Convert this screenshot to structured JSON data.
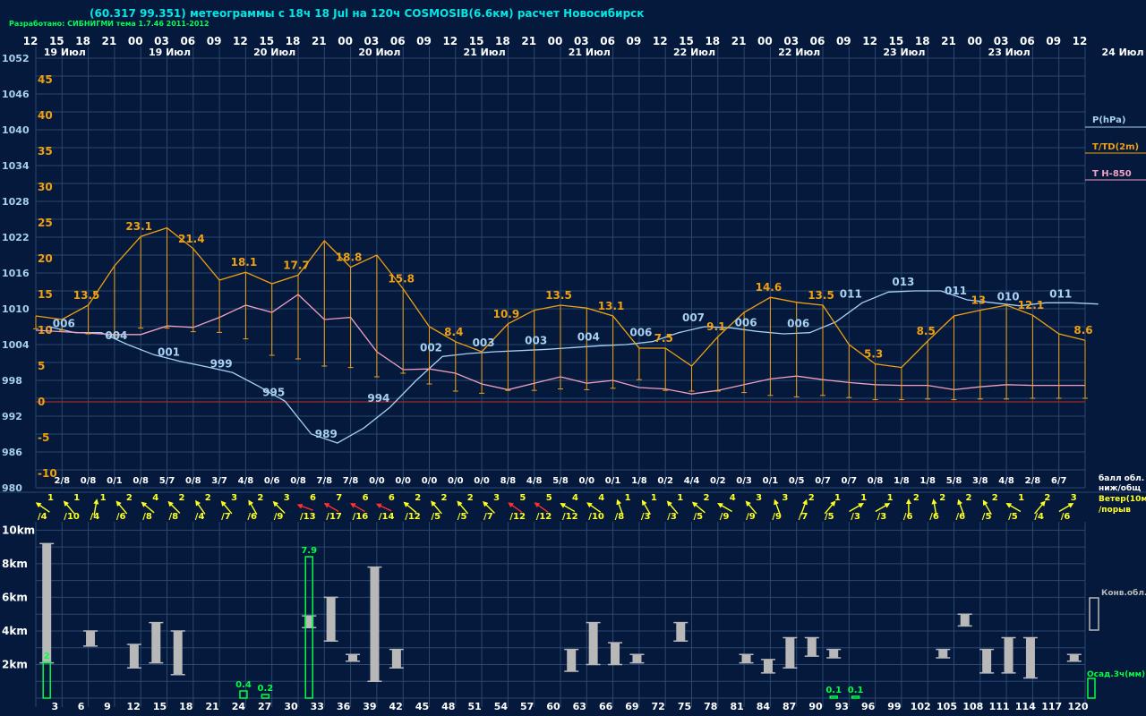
{
  "header": {
    "title": "(60.317 99.351) метеограммы с  18ч 18 Jul на 120ч COSMOSIB(6.6км) расчет Новосибирск",
    "credit": "Разработано: СИБНИГМИ тема 1.7.46 2011-2012"
  },
  "colors": {
    "pressure": "#a8d0f0",
    "temperature": "#f0a010",
    "t850": "#f0a0c0",
    "grid": "#2a4870",
    "zero_line": "#a02828",
    "wind": "#ffff20",
    "wind_strong": "#ff3030",
    "cloud_bar": "#b8b8b8",
    "precip": "#00ff40",
    "text_white": "#ffffff",
    "label_blue": "#a8d0f0",
    "label_orange": "#f0a010"
  },
  "chart_data": {
    "type": "line",
    "hour_ticks": [
      "12",
      "15",
      "18",
      "21",
      "00",
      "03",
      "06",
      "09",
      "12",
      "15",
      "18",
      "21",
      "00",
      "03",
      "06",
      "09",
      "12",
      "15",
      "18",
      "21",
      "00",
      "03",
      "06",
      "09",
      "12",
      "15",
      "18",
      "21",
      "00",
      "03",
      "06",
      "09",
      "12",
      "15",
      "18",
      "21",
      "00",
      "03",
      "06",
      "09",
      "12"
    ],
    "date_labels": [
      {
        "label": "19 Июл",
        "step": 1
      },
      {
        "label": "19 Июл",
        "step": 5
      },
      {
        "label": "20 Июл",
        "step": 9
      },
      {
        "label": "20 Июл",
        "step": 13
      },
      {
        "label": "21 Июл",
        "step": 17
      },
      {
        "label": "21 Июл",
        "step": 21
      },
      {
        "label": "22 Июл",
        "step": 25
      },
      {
        "label": "22 Июл",
        "step": 29
      },
      {
        "label": "23 Июл",
        "step": 33
      },
      {
        "label": "23 Июл",
        "step": 37
      }
    ],
    "right_date": "24 Июл",
    "pressure_axis": {
      "label": "P(hPa)",
      "ticks": [
        "1052",
        "1046",
        "1040",
        "1034",
        "1028",
        "1022",
        "1016",
        "1010",
        "1004",
        "998",
        "992",
        "986",
        "980"
      ],
      "range": [
        980,
        1052
      ]
    },
    "temp_axis": {
      "label": "T/TD(2m)",
      "ticks": [
        "45",
        "40",
        "35",
        "30",
        "25",
        "20",
        "15",
        "10",
        "5",
        "0",
        "-5",
        "-10"
      ],
      "range": [
        -12,
        48
      ]
    },
    "t850_label": "T H-850",
    "pressure": [
      1009,
      1007,
      1006,
      1006,
      1004,
      1002.3,
      1001.2,
      1000.3,
      999.3,
      997,
      994.5,
      989,
      987.5,
      990,
      993.5,
      998,
      1002,
      1002.5,
      1002.8,
      1003,
      1003.2,
      1003.5,
      1003.8,
      1004,
      1004.5,
      1006,
      1007,
      1006.8,
      1006.2,
      1005.8,
      1006,
      1007.8,
      1011,
      1012.8,
      1013,
      1013,
      1011.5,
      1011,
      1010.5,
      1011,
      1011,
      1010.8
    ],
    "pressure_labels": [
      {
        "i": 1,
        "text": "006"
      },
      {
        "i": 3,
        "text": "004"
      },
      {
        "i": 5,
        "text": "001"
      },
      {
        "i": 7,
        "text": "999"
      },
      {
        "i": 9,
        "text": "995"
      },
      {
        "i": 11,
        "text": "989"
      },
      {
        "i": 13,
        "text": "994"
      },
      {
        "i": 15,
        "text": "002"
      },
      {
        "i": 17,
        "text": "003"
      },
      {
        "i": 19,
        "text": "003"
      },
      {
        "i": 21,
        "text": "004"
      },
      {
        "i": 23,
        "text": "006"
      },
      {
        "i": 25,
        "text": "007"
      },
      {
        "i": 27,
        "text": "006"
      },
      {
        "i": 29,
        "text": "006"
      },
      {
        "i": 31,
        "text": "011"
      },
      {
        "i": 33,
        "text": "013"
      },
      {
        "i": 35,
        "text": "011"
      },
      {
        "i": 37,
        "text": "010"
      },
      {
        "i": 39,
        "text": "011"
      }
    ],
    "temperature": [
      12,
      11.5,
      13.5,
      19,
      23.1,
      24.3,
      21.4,
      17,
      18.1,
      16.5,
      17.7,
      22.5,
      18.8,
      20.5,
      15.8,
      10.5,
      8.4,
      7,
      10.9,
      12.8,
      13.5,
      13.1,
      12,
      7.5,
      7.5,
      5,
      9.1,
      12.5,
      14.6,
      13.9,
      13.5,
      8,
      5.3,
      4.8,
      8.5,
      12,
      12.8,
      13.5,
      12.1,
      9.5,
      8.6
    ],
    "dew_point": [
      10.2,
      10,
      9.5,
      9.2,
      10.3,
      10.3,
      9.8,
      9.7,
      8.8,
      6.5,
      6,
      5,
      4.8,
      3.5,
      4,
      2.5,
      1.5,
      1.2,
      1.6,
      1.6,
      1.8,
      1.7,
      1.9,
      3.1,
      1.6,
      1.5,
      1.5,
      1.3,
      0.9,
      0.7,
      0.9,
      0.6,
      0.3,
      0.3,
      0.4,
      0.3,
      0.4,
      0.4,
      0.5,
      0.5,
      0.5
    ],
    "temperature_labels": [
      {
        "i": 2,
        "text": "13.5"
      },
      {
        "i": 4,
        "text": "23.1"
      },
      {
        "i": 6,
        "text": "21.4"
      },
      {
        "i": 8,
        "text": "18.1"
      },
      {
        "i": 10,
        "text": "17.7"
      },
      {
        "i": 12,
        "text": "18.8"
      },
      {
        "i": 14,
        "text": "15.8"
      },
      {
        "i": 16,
        "text": "8.4"
      },
      {
        "i": 18,
        "text": "10.9"
      },
      {
        "i": 20,
        "text": "13.5"
      },
      {
        "i": 22,
        "text": "13.1"
      },
      {
        "i": 24,
        "text": "7.5"
      },
      {
        "i": 26,
        "text": "9.1"
      },
      {
        "i": 28,
        "text": "14.6"
      },
      {
        "i": 30,
        "text": "13.5"
      },
      {
        "i": 32,
        "text": "5.3"
      },
      {
        "i": 34,
        "text": "8.5"
      },
      {
        "i": 36,
        "text": "13"
      },
      {
        "i": 38,
        "text": "12.1"
      },
      {
        "i": 40,
        "text": "8.6"
      }
    ],
    "t850": [
      10,
      9.8,
      9.6,
      9.4,
      9.4,
      10.6,
      10.4,
      11.8,
      13.5,
      12.5,
      15,
      11.5,
      11.8,
      7,
      4.5,
      4.6,
      4,
      2.5,
      1.7,
      2.6,
      3.5,
      2.6,
      3,
      2,
      1.8,
      1.1,
      1.6,
      2.4,
      3.2,
      3.6,
      3.1,
      2.7,
      2.4,
      2.3,
      2.3,
      1.7,
      2.1,
      2.4,
      2.3,
      2.3,
      2.3
    ],
    "clouds": [
      "2/8",
      "0/8",
      "0/1",
      "0/8",
      "5/7",
      "0/8",
      "3/7",
      "4/8",
      "0/6",
      "0/8",
      "7/8",
      "7/8",
      "0/0",
      "0/0",
      "0/0",
      "0/0",
      "0/0",
      "8/8",
      "4/8",
      "5/8",
      "0/0",
      "0/1",
      "1/8",
      "0/2",
      "4/4",
      "0/2",
      "0/3",
      "0/1",
      "0/5",
      "0/7",
      "0/7",
      "0/8",
      "1/8",
      "1/8",
      "5/8",
      "3/8",
      "4/8",
      "2/8",
      "6/7"
    ],
    "clouds_caption": [
      "балл обл.",
      "ниж/общ"
    ],
    "wind_caption": [
      "Ветер(10м",
      "/порыв"
    ],
    "wind": [
      {
        "s": "1",
        "g": "/4",
        "a": -55
      },
      {
        "s": "1",
        "g": "/10",
        "a": -40
      },
      {
        "s": "1",
        "g": "/4",
        "a": 10
      },
      {
        "s": "2",
        "g": "/6",
        "a": -40
      },
      {
        "s": "4",
        "g": "/8",
        "a": -50
      },
      {
        "s": "2",
        "g": "/8",
        "a": -45
      },
      {
        "s": "2",
        "g": "/4",
        "a": -35
      },
      {
        "s": "3",
        "g": "/7",
        "a": -40
      },
      {
        "s": "2",
        "g": "/6",
        "a": -30
      },
      {
        "s": "3",
        "g": "/9",
        "a": -45
      },
      {
        "s": "6",
        "g": "/13",
        "a": -70,
        "strong": true
      },
      {
        "s": "7",
        "g": "/17",
        "a": -60,
        "strong": true
      },
      {
        "s": "6",
        "g": "/16",
        "a": -60,
        "strong": true
      },
      {
        "s": "6",
        "g": "/14",
        "a": -65,
        "strong": true
      },
      {
        "s": "2",
        "g": "/12",
        "a": -50
      },
      {
        "s": "2",
        "g": "/5",
        "a": -40
      },
      {
        "s": "2",
        "g": "/5",
        "a": -40
      },
      {
        "s": "3",
        "g": "/7",
        "a": -45
      },
      {
        "s": "5",
        "g": "/12",
        "a": -55,
        "strong": true
      },
      {
        "s": "5",
        "g": "/12",
        "a": -55,
        "strong": true
      },
      {
        "s": "4",
        "g": "/12",
        "a": -60
      },
      {
        "s": "4",
        "g": "/10",
        "a": -55
      },
      {
        "s": "1",
        "g": "/8",
        "a": -20
      },
      {
        "s": "1",
        "g": "/3",
        "a": -30
      },
      {
        "s": "1",
        "g": "/3",
        "a": -40
      },
      {
        "s": "2",
        "g": "/5",
        "a": -50
      },
      {
        "s": "4",
        "g": "/9",
        "a": -60
      },
      {
        "s": "3",
        "g": "/9",
        "a": -40
      },
      {
        "s": "3",
        "g": "/9",
        "a": -20
      },
      {
        "s": "2",
        "g": "/7",
        "a": 20
      },
      {
        "s": "1",
        "g": "/5",
        "a": 40
      },
      {
        "s": "1",
        "g": "/3",
        "a": 60
      },
      {
        "s": "1",
        "g": "/3",
        "a": 60
      },
      {
        "s": "2",
        "g": "/6",
        "a": 0
      },
      {
        "s": "2",
        "g": "/6",
        "a": -10
      },
      {
        "s": "2",
        "g": "/6",
        "a": -20
      },
      {
        "s": "2",
        "g": "/5",
        "a": -30
      },
      {
        "s": "1",
        "g": "/5",
        "a": -60
      },
      {
        "s": "2",
        "g": "/4",
        "a": 40
      },
      {
        "s": "3",
        "g": "/6",
        "a": 60
      }
    ],
    "height_axis": {
      "ticks": [
        "10km",
        "8km",
        "6km",
        "4km",
        "2km"
      ],
      "range": [
        0,
        10.5
      ]
    },
    "cloud_bars": [
      {
        "i": 1,
        "lo": 2.1,
        "hi": 9.2
      },
      {
        "i": 3,
        "lo": 3.1,
        "hi": 4.0
      },
      {
        "i": 5,
        "lo": 1.8,
        "hi": 3.2
      },
      {
        "i": 6,
        "lo": 2.1,
        "hi": 4.5
      },
      {
        "i": 7,
        "lo": 1.4,
        "hi": 4.0
      },
      {
        "i": 13,
        "lo": 4.2,
        "hi": 4.9
      },
      {
        "i": 14,
        "lo": 3.4,
        "hi": 6.0
      },
      {
        "i": 15,
        "lo": 2.2,
        "hi": 2.6
      },
      {
        "i": 16,
        "lo": 1.0,
        "hi": 7.8
      },
      {
        "i": 17,
        "lo": 1.8,
        "hi": 2.9
      },
      {
        "i": 25,
        "lo": 1.6,
        "hi": 2.9
      },
      {
        "i": 26,
        "lo": 2.0,
        "hi": 4.5
      },
      {
        "i": 27,
        "lo": 2.0,
        "hi": 3.3
      },
      {
        "i": 28,
        "lo": 2.1,
        "hi": 2.6
      },
      {
        "i": 30,
        "lo": 3.4,
        "hi": 4.5
      },
      {
        "i": 33,
        "lo": 2.1,
        "hi": 2.6
      },
      {
        "i": 34,
        "lo": 1.5,
        "hi": 2.3
      },
      {
        "i": 35,
        "lo": 1.8,
        "hi": 3.6
      },
      {
        "i": 36,
        "lo": 2.5,
        "hi": 3.6
      },
      {
        "i": 37,
        "lo": 2.4,
        "hi": 2.9
      },
      {
        "i": 42,
        "lo": 2.4,
        "hi": 2.9
      },
      {
        "i": 43,
        "lo": 4.3,
        "hi": 5.0
      },
      {
        "i": 44,
        "lo": 1.5,
        "hi": 2.9
      },
      {
        "i": 45,
        "lo": 1.5,
        "hi": 3.6
      },
      {
        "i": 46,
        "lo": 1.2,
        "hi": 3.6
      },
      {
        "i": 48,
        "lo": 2.2,
        "hi": 2.6
      }
    ],
    "precip_bars": [
      {
        "i": 1,
        "v": 2,
        "label": "2"
      },
      {
        "i": 10,
        "v": 0.4,
        "label": "0.4"
      },
      {
        "i": 11,
        "v": 0.2,
        "label": "0.2"
      },
      {
        "i": 13,
        "v": 7.9,
        "label": "7.9"
      },
      {
        "i": 37,
        "v": 0.1,
        "label": "0.1"
      },
      {
        "i": 38,
        "v": 0.1,
        "label": "0.1"
      }
    ],
    "precip_scale_max": 9,
    "bottom_hours": [
      "3",
      "6",
      "9",
      "12",
      "15",
      "18",
      "21",
      "24",
      "27",
      "30",
      "33",
      "36",
      "39",
      "42",
      "45",
      "48",
      "51",
      "54",
      "57",
      "60",
      "63",
      "66",
      "69",
      "72",
      "75",
      "78",
      "81",
      "84",
      "87",
      "90",
      "93",
      "96",
      "99",
      "102",
      "105",
      "108",
      "111",
      "114",
      "117",
      "120"
    ],
    "conv_label": "Конв.обл.",
    "precip_label": "Осад.3ч(мм)"
  }
}
